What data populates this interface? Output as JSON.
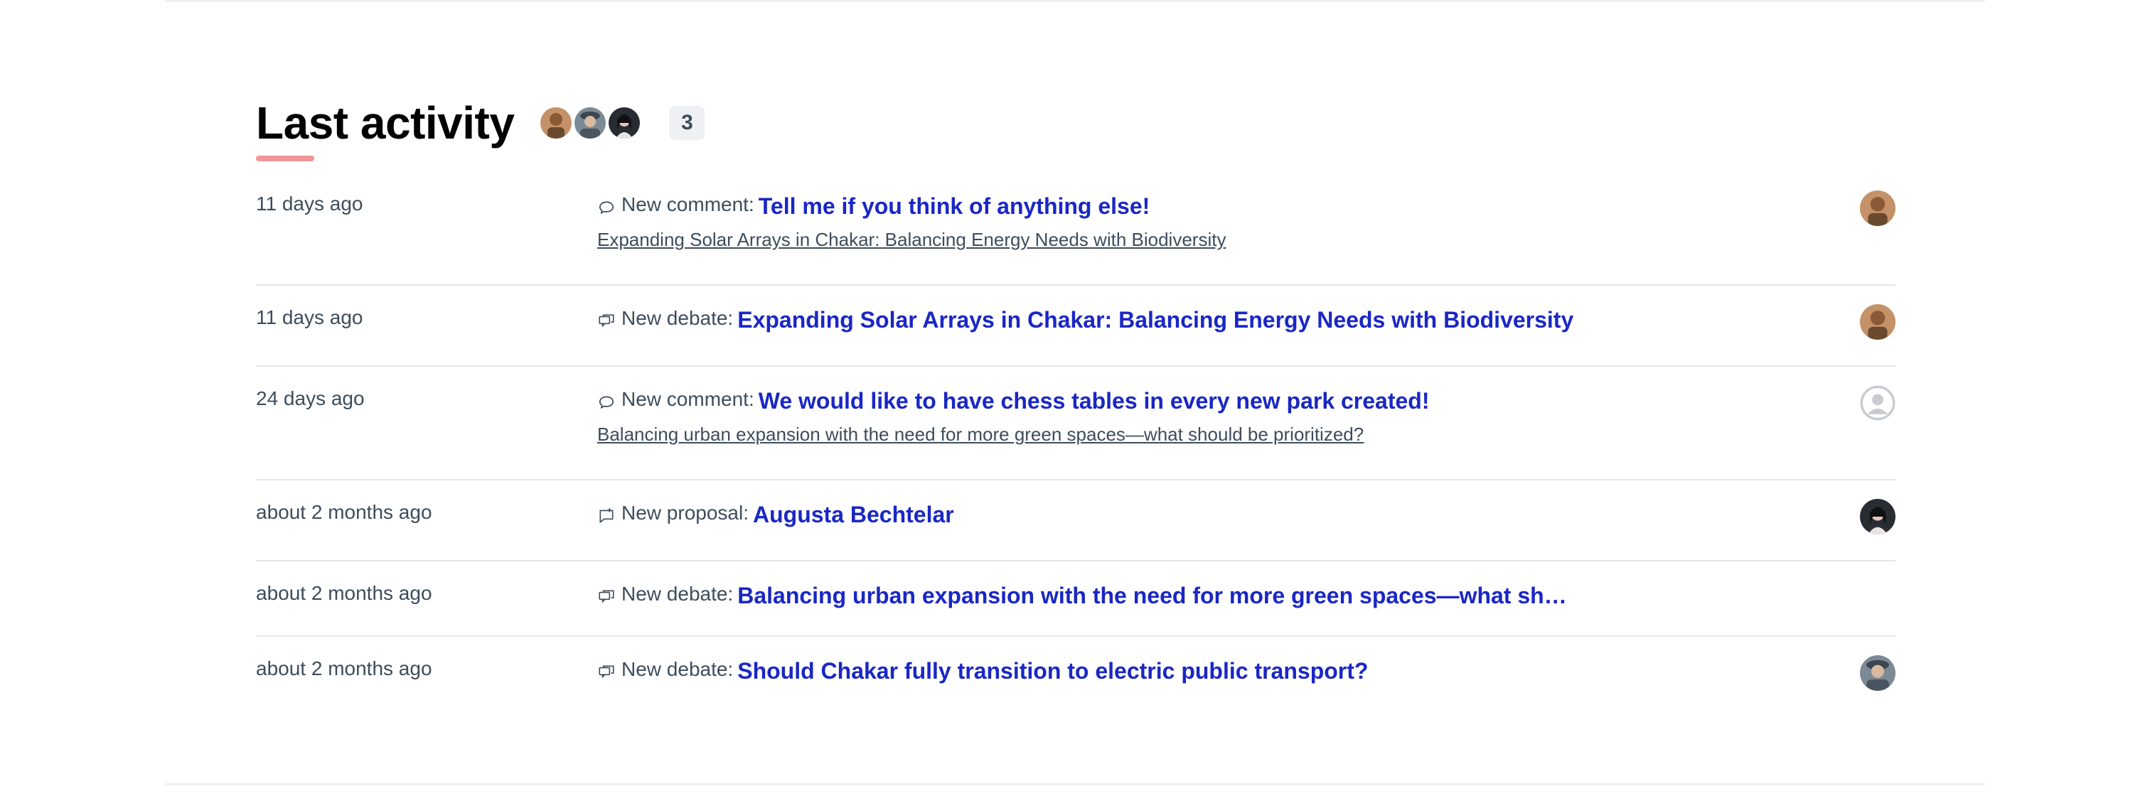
{
  "section": {
    "title": "Last activity",
    "participants_count": "3",
    "participants": [
      "user-tan",
      "user-hat",
      "user-dark-hair"
    ]
  },
  "activities": [
    {
      "time": "11 days ago",
      "kind_label": "New comment:",
      "kind_icon": "comment-icon",
      "link": "Tell me if you think of anything else!",
      "sub": "Expanding Solar Arrays in Chakar: Balancing Energy Needs with Biodiversity",
      "avatar": "user-tan"
    },
    {
      "time": "11 days ago",
      "kind_label": "New debate:",
      "kind_icon": "debate-icon",
      "link": "Expanding Solar Arrays in Chakar: Balancing Energy Needs with Biodiversity",
      "avatar": "user-tan"
    },
    {
      "time": "24 days ago",
      "kind_label": "New comment:",
      "kind_icon": "comment-icon",
      "link": "We would like to have chess tables in every new park created!",
      "sub": "Balancing urban expansion with the need for more green spaces—what should be prioritized?",
      "avatar": "default-avatar"
    },
    {
      "time": "about 2 months ago",
      "kind_label": "New proposal:",
      "kind_icon": "proposal-icon",
      "link": "Augusta Bechtelar",
      "avatar": "user-dark-hair"
    },
    {
      "time": "about 2 months ago",
      "kind_label": "New debate:",
      "kind_icon": "debate-icon",
      "link": "Balancing urban expansion with the need for more green spaces—what should be pri…",
      "avatar": ""
    },
    {
      "time": "about 2 months ago",
      "kind_label": "New debate:",
      "kind_icon": "debate-icon",
      "link": "Should Chakar fully transition to electric public transport?",
      "avatar": "user-hat"
    }
  ],
  "colors": {
    "link": "#1a27c4",
    "title": "#020203",
    "underline": "#f0959a",
    "text": "#3e4c5c"
  }
}
